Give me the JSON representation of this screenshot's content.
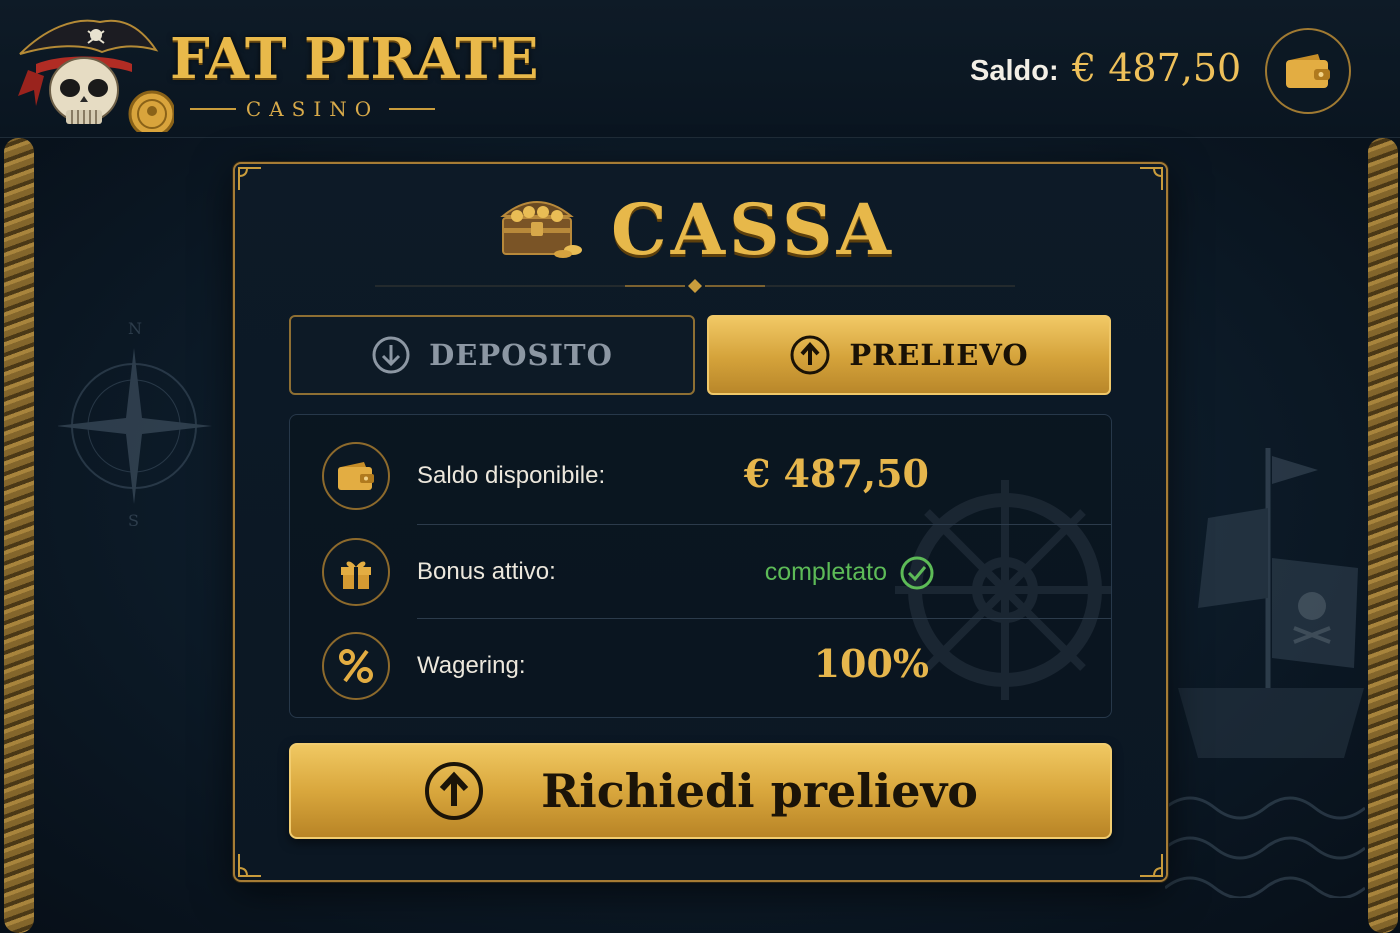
{
  "header": {
    "brand_name": "FAT PIRATE",
    "brand_sub": "CASINO",
    "balance_label": "Saldo:",
    "balance_value": "€ 487,50"
  },
  "panel": {
    "title": "CASSA",
    "tabs": [
      {
        "label": "DEPOSITO",
        "icon": "arrow-down-circle-icon",
        "active": false
      },
      {
        "label": "PRELIEVO",
        "icon": "arrow-up-circle-icon",
        "active": true
      }
    ],
    "info": {
      "available_balance_label": "Saldo disponibile:",
      "available_balance_value": "€ 487,50",
      "bonus_label": "Bonus attivo:",
      "bonus_value": "completato",
      "wagering_label": "Wagering:",
      "wagering_value": "100%"
    },
    "cta_label": "Richiedi prelievo"
  },
  "colors": {
    "gold": "#e6b64c",
    "success": "#5dbb57",
    "background": "#0b1622"
  },
  "icons": [
    "skull-pirate-icon",
    "coin-icon",
    "wallet-icon",
    "treasure-chest-icon",
    "gift-icon",
    "percent-icon",
    "check-circle-icon",
    "compass-icon",
    "ship-wheel-icon",
    "pirate-ship-icon"
  ]
}
